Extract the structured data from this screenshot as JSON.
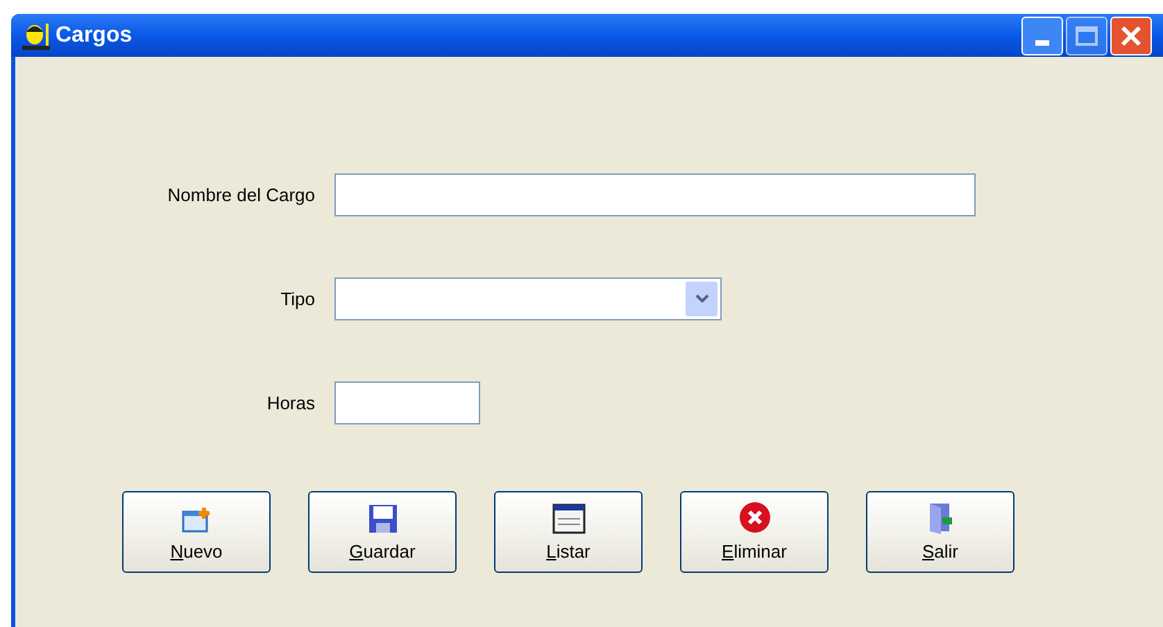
{
  "window": {
    "title": "Cargos"
  },
  "fields": [
    {
      "label": "Nombre del Cargo",
      "kind": "text"
    },
    {
      "label": "Tipo",
      "kind": "combo"
    },
    {
      "label": "Horas",
      "kind": "text"
    }
  ],
  "buttons": [
    {
      "key": "N",
      "rest": "uevo",
      "kind": "new"
    },
    {
      "key": "G",
      "rest": "uardar",
      "kind": "save"
    },
    {
      "key": "L",
      "rest": "istar",
      "kind": "list"
    },
    {
      "key": "E",
      "rest": "liminar",
      "kind": "delete"
    },
    {
      "key": "S",
      "rest": "alir",
      "kind": "exit"
    }
  ]
}
